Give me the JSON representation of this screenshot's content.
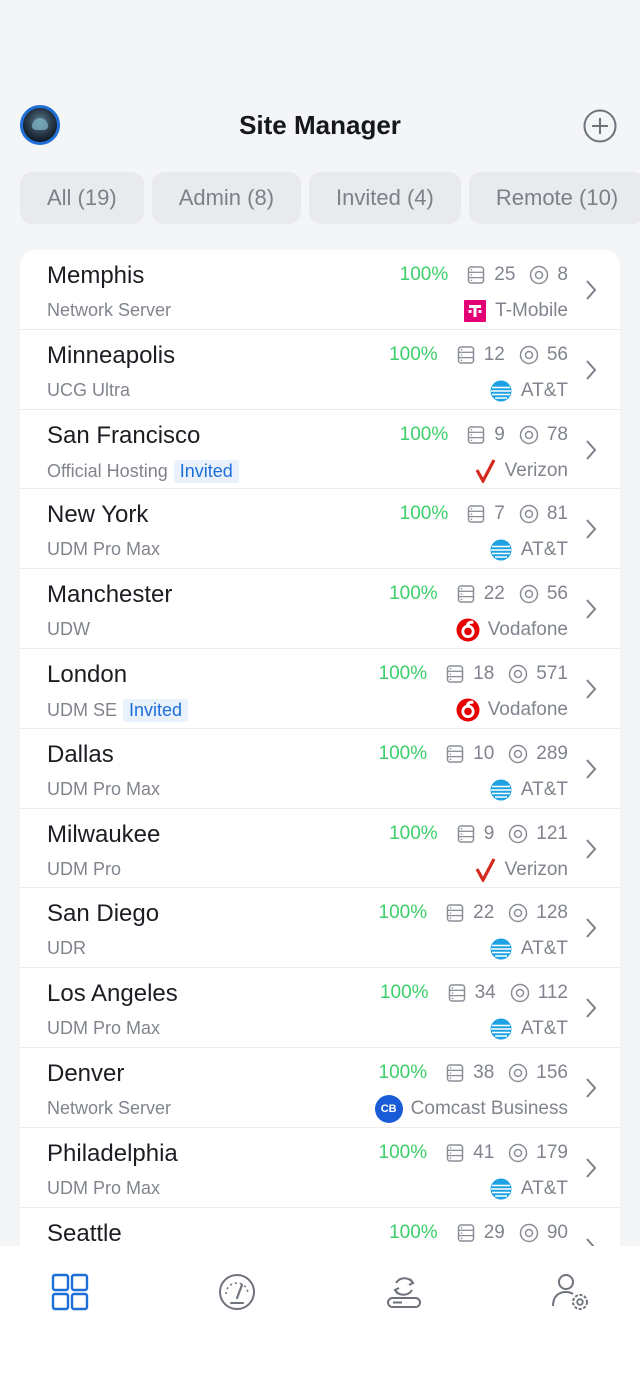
{
  "header": {
    "title": "Site Manager"
  },
  "tabs": [
    {
      "label": "All (19)"
    },
    {
      "label": "Admin (8)"
    },
    {
      "label": "Invited (4)"
    },
    {
      "label": "Remote (10)"
    }
  ],
  "sites": [
    {
      "name": "Memphis",
      "device": "Network Server",
      "invited": "",
      "pct": "100%",
      "devices": "25",
      "clients": "8",
      "isp": "T-Mobile",
      "isp_logo": "tmobile-logo"
    },
    {
      "name": "Minneapolis",
      "device": "UCG Ultra",
      "invited": "",
      "pct": "100%",
      "devices": "12",
      "clients": "56",
      "isp": "AT&T",
      "isp_logo": "att-logo"
    },
    {
      "name": "San Francisco",
      "device": "Official Hosting",
      "invited": "Invited",
      "pct": "100%",
      "devices": "9",
      "clients": "78",
      "isp": "Verizon",
      "isp_logo": "verizon-logo"
    },
    {
      "name": "New York",
      "device": "UDM Pro Max",
      "invited": "",
      "pct": "100%",
      "devices": "7",
      "clients": "81",
      "isp": "AT&T",
      "isp_logo": "att-logo"
    },
    {
      "name": "Manchester",
      "device": "UDW",
      "invited": "",
      "pct": "100%",
      "devices": "22",
      "clients": "56",
      "isp": "Vodafone",
      "isp_logo": "vodafone-logo"
    },
    {
      "name": "London",
      "device": "UDM SE",
      "invited": "Invited",
      "pct": "100%",
      "devices": "18",
      "clients": "571",
      "isp": "Vodafone",
      "isp_logo": "vodafone-logo"
    },
    {
      "name": "Dallas",
      "device": "UDM Pro Max",
      "invited": "",
      "pct": "100%",
      "devices": "10",
      "clients": "289",
      "isp": "AT&T",
      "isp_logo": "att-logo"
    },
    {
      "name": "Milwaukee",
      "device": "UDM Pro",
      "invited": "",
      "pct": "100%",
      "devices": "9",
      "clients": "121",
      "isp": "Verizon",
      "isp_logo": "verizon-logo"
    },
    {
      "name": "San Diego",
      "device": "UDR",
      "invited": "",
      "pct": "100%",
      "devices": "22",
      "clients": "128",
      "isp": "AT&T",
      "isp_logo": "att-logo"
    },
    {
      "name": "Los Angeles",
      "device": "UDM Pro Max",
      "invited": "",
      "pct": "100%",
      "devices": "34",
      "clients": "112",
      "isp": "AT&T",
      "isp_logo": "att-logo"
    },
    {
      "name": "Denver",
      "device": "Network Server",
      "invited": "",
      "pct": "100%",
      "devices": "38",
      "clients": "156",
      "isp": "Comcast Business",
      "isp_logo": "comcast-business-logo",
      "isp_logo_text": "CB"
    },
    {
      "name": "Philadelphia",
      "device": "UDM Pro Max",
      "invited": "",
      "pct": "100%",
      "devices": "41",
      "clients": "179",
      "isp": "AT&T",
      "isp_logo": "att-logo"
    },
    {
      "name": "Seattle",
      "device": "",
      "invited": "",
      "pct": "100%",
      "devices": "29",
      "clients": "90",
      "isp": "",
      "isp_logo": ""
    }
  ],
  "bottom_nav": [
    {
      "icon": "grid-icon",
      "active": true
    },
    {
      "icon": "speedometer-icon",
      "active": false
    },
    {
      "icon": "sync-device-icon",
      "active": false
    },
    {
      "icon": "user-settings-icon",
      "active": false
    }
  ],
  "colors": {
    "accent": "#1d6fd8",
    "online_green": "#3bcf6a",
    "tmobile": "#e20074",
    "att": "#1ea2e4",
    "verizon": "#d52b1e",
    "vodafone": "#e60000",
    "comcast": "#1a5cd8"
  }
}
